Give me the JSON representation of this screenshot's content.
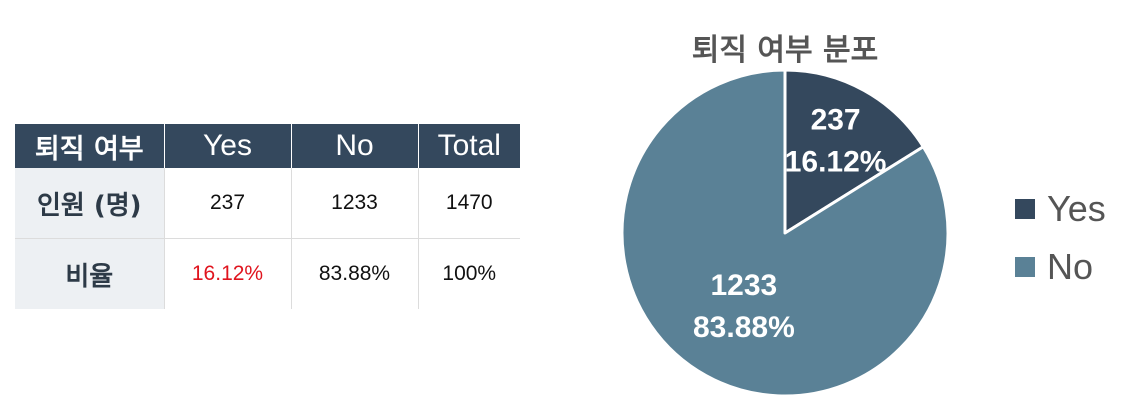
{
  "table": {
    "header": [
      "퇴직 여부",
      "Yes",
      "No",
      "Total"
    ],
    "rows": [
      {
        "label": "인원 (명)",
        "yes": "237",
        "no": "1233",
        "total": "1470"
      },
      {
        "label": "비율",
        "yes": "16.12%",
        "no": "83.88%",
        "total": "100%"
      }
    ],
    "highlight_color": "#e0141e",
    "header_color": "#34485d"
  },
  "chart_data": {
    "type": "pie",
    "title": "퇴직 여부 분포",
    "categories": [
      "Yes",
      "No"
    ],
    "values": [
      237,
      1233
    ],
    "data_labels": [
      {
        "count": "237",
        "percent": "16.12%"
      },
      {
        "count": "1233",
        "percent": "83.88%"
      }
    ],
    "colors": [
      "#34485d",
      "#5a8196"
    ],
    "legend": {
      "position": "right",
      "items": [
        "Yes",
        "No"
      ]
    }
  }
}
